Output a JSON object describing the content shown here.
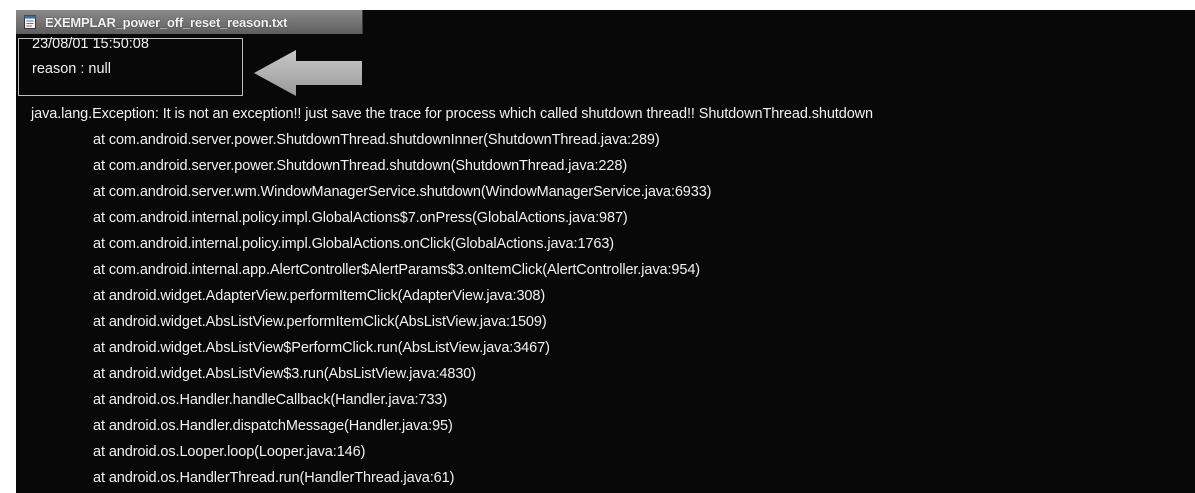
{
  "window": {
    "title": "EXEMPLAR_power_off_reset_reason.txt",
    "title_icon": "text-file-icon"
  },
  "meta": {
    "timestamp": "23/08/01 15:50:08",
    "reason": "reason : null"
  },
  "annotation": {
    "icon": "arrow-left-icon"
  },
  "log": {
    "exception": "java.lang.Exception: It is not an exception!! just save the trace for process which called shutdown thread!! ShutdownThread.shutdown",
    "frames": [
      "at com.android.server.power.ShutdownThread.shutdownInner(ShutdownThread.java:289)",
      "at com.android.server.power.ShutdownThread.shutdown(ShutdownThread.java:228)",
      "at com.android.server.wm.WindowManagerService.shutdown(WindowManagerService.java:6933)",
      "at com.android.internal.policy.impl.GlobalActions$7.onPress(GlobalActions.java:987)",
      "at com.android.internal.policy.impl.GlobalActions.onClick(GlobalActions.java:1763)",
      "at com.android.internal.app.AlertController$AlertParams$3.onItemClick(AlertController.java:954)",
      "at android.widget.AdapterView.performItemClick(AdapterView.java:308)",
      "at android.widget.AbsListView.performItemClick(AbsListView.java:1509)",
      "at android.widget.AbsListView$PerformClick.run(AbsListView.java:3467)",
      "at android.widget.AbsListView$3.run(AbsListView.java:4830)",
      "at android.os.Handler.handleCallback(Handler.java:733)",
      "at android.os.Handler.dispatchMessage(Handler.java:95)",
      "at android.os.Looper.loop(Looper.java:146)",
      "at android.os.HandlerThread.run(HandlerThread.java:61)"
    ]
  }
}
